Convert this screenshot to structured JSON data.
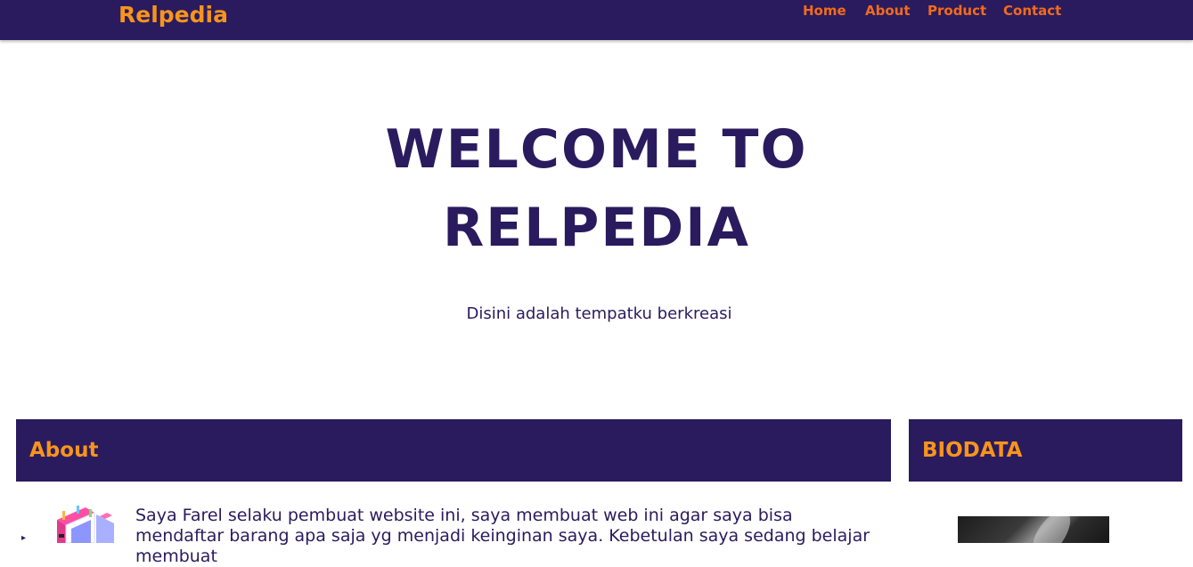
{
  "navbar": {
    "brand": "Relpedia",
    "links": [
      {
        "label": "Home"
      },
      {
        "label": "About"
      },
      {
        "label": "Product"
      },
      {
        "label": "Contact"
      }
    ]
  },
  "hero": {
    "title_line1": "WELCOME TO",
    "title_line2": "RELPEDIA",
    "subtitle": "Disini adalah tempatku berkreasi"
  },
  "about": {
    "heading": "About",
    "text": "Saya Farel selaku pembuat website ini, saya membuat web ini agar saya bisa mendaftar barang apa saja yg menjadi keinginan saya. Kebetulan saya sedang belajar membuat"
  },
  "biodata": {
    "heading": "BIODATA"
  },
  "colors": {
    "navy": "#2a1b5e",
    "orange": "#f7941d",
    "nav_link": "#f26b1d"
  }
}
